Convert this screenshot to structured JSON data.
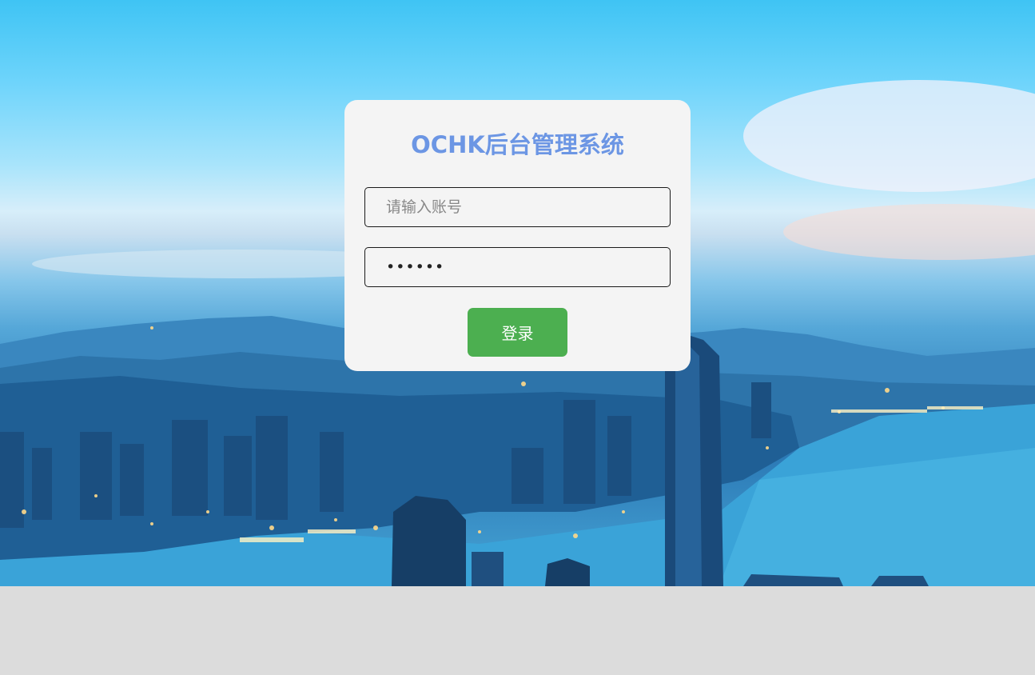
{
  "login": {
    "title": "OCHK后台管理系统",
    "username_placeholder": "请输入账号",
    "username_value": "",
    "password_value": "••••••",
    "submit_label": "登录"
  },
  "colors": {
    "title": "#6c96e4",
    "button": "#4caf50",
    "card": "#f4f4f4",
    "page_bottom": "#dcdcdc"
  },
  "background": {
    "subject": "city-skyline-harbor-photo"
  }
}
